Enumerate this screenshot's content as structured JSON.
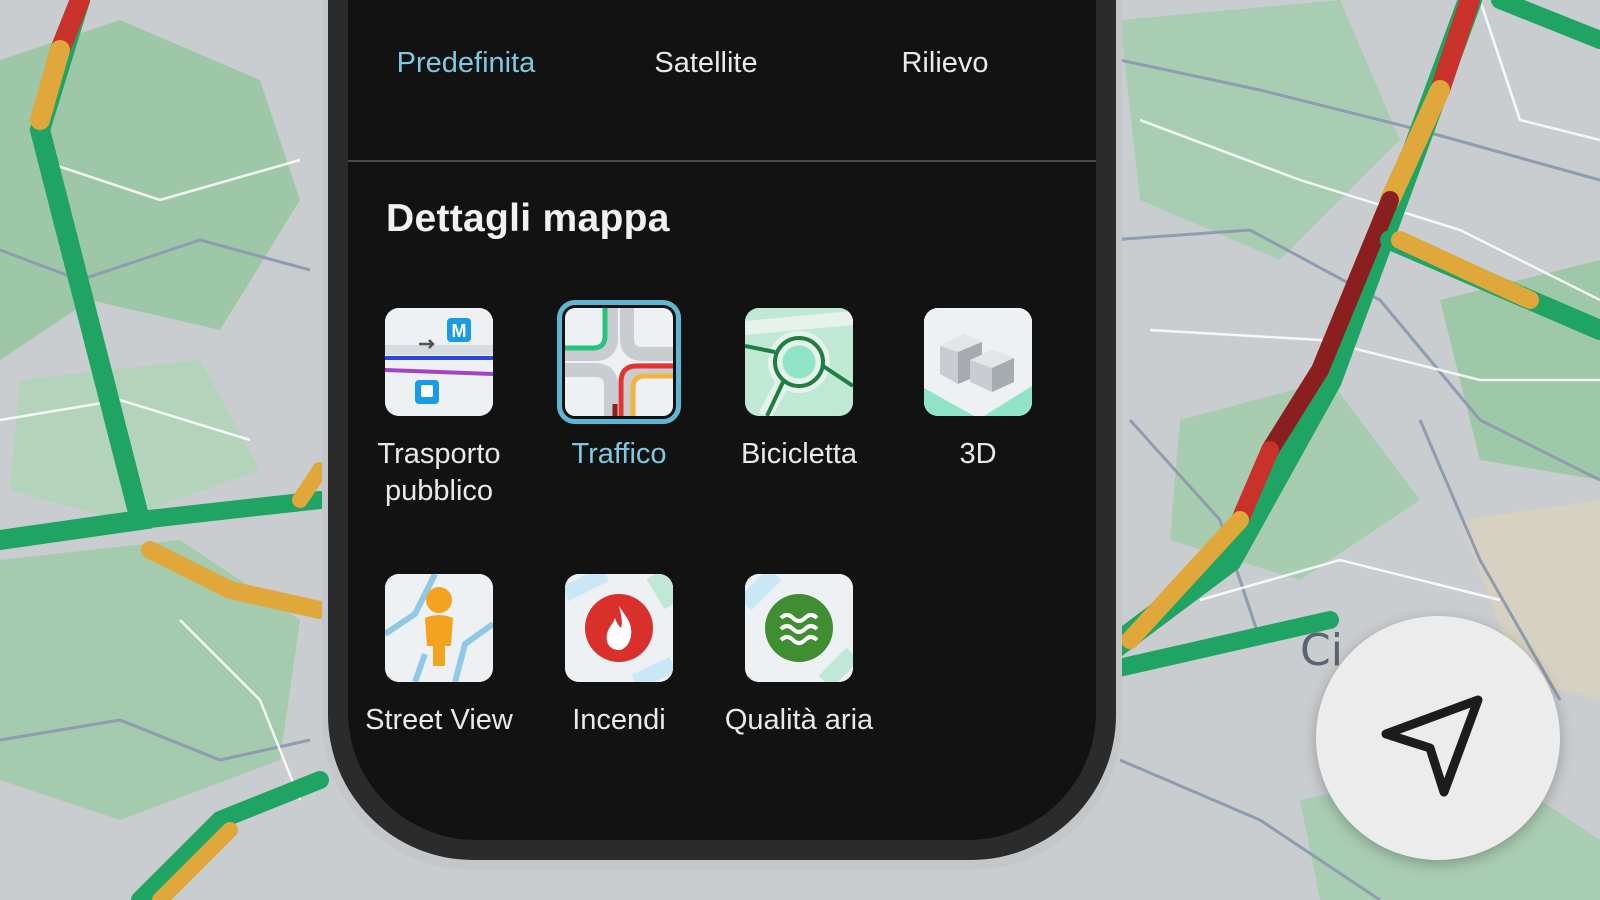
{
  "map_types": [
    {
      "label": "Predefinita",
      "active": true,
      "icon": "default-map-icon"
    },
    {
      "label": "Satellite",
      "active": false,
      "icon": "satellite-map-icon"
    },
    {
      "label": "Rilievo",
      "active": false,
      "icon": "terrain-map-icon"
    }
  ],
  "map_details": {
    "title": "Dettagli mappa",
    "items": [
      {
        "label": "Trasporto pubblico",
        "selected": false,
        "icon": "transit-icon"
      },
      {
        "label": "Traffico",
        "selected": true,
        "icon": "traffic-icon"
      },
      {
        "label": "Bicicletta",
        "selected": false,
        "icon": "bicycle-icon"
      },
      {
        "label": "3D",
        "selected": false,
        "icon": "3d-buildings-icon"
      },
      {
        "label": "Street View",
        "selected": false,
        "icon": "street-view-icon"
      },
      {
        "label": "Incendi",
        "selected": false,
        "icon": "wildfires-icon"
      },
      {
        "label": "Qualità aria",
        "selected": false,
        "icon": "air-quality-icon"
      }
    ]
  },
  "navigate_button": {
    "icon": "navigation-arrow-icon"
  },
  "colors": {
    "accent": "#7cc9e0",
    "traffic_green": "#1fa463",
    "traffic_yellow": "#e0a73a",
    "traffic_red": "#c8322a",
    "traffic_darkred": "#8b1e1e",
    "sheet_bg": "#121212"
  }
}
